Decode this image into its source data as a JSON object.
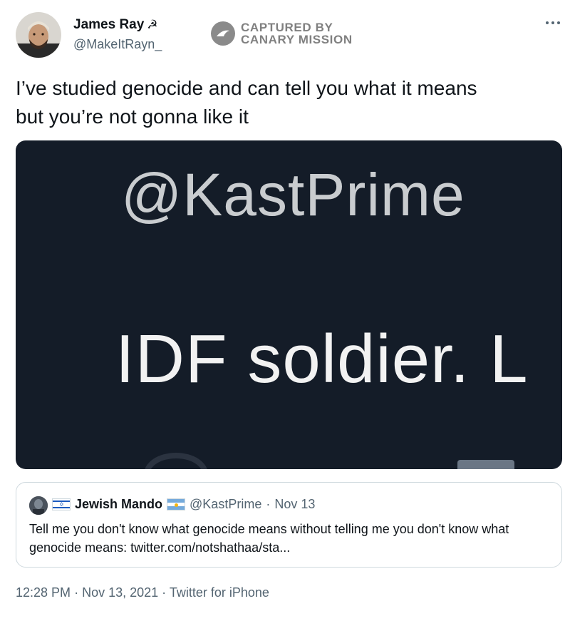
{
  "author": {
    "name": "James Ray",
    "flag_glyph": "☭",
    "handle": "@MakeItRayn_"
  },
  "watermark": {
    "line1": "CAPTURED BY",
    "line2": "CANARY MISSION"
  },
  "tweet": {
    "text_line1": "I’ve studied genocide and can tell you what it means",
    "text_line2": "but you’re not gonna like it"
  },
  "media": {
    "handle_text": "@KastPrime",
    "body_text": "IDF soldier. L"
  },
  "quote": {
    "name": "Jewish Mando",
    "handle": "@KastPrime",
    "separator": "·",
    "date": "Nov 13",
    "text": "Tell me you don't know what genocide means without telling me you don't know what genocide means: twitter.com/notshathaa/sta..."
  },
  "footer": {
    "time": "12:28 PM",
    "sep1": "·",
    "date": "Nov 13, 2021",
    "sep2": "·",
    "source": "Twitter for iPhone"
  },
  "colors": {
    "text_primary": "#0f1419",
    "text_secondary": "#536471",
    "media_background": "#141c28",
    "border": "#cfd9de"
  }
}
